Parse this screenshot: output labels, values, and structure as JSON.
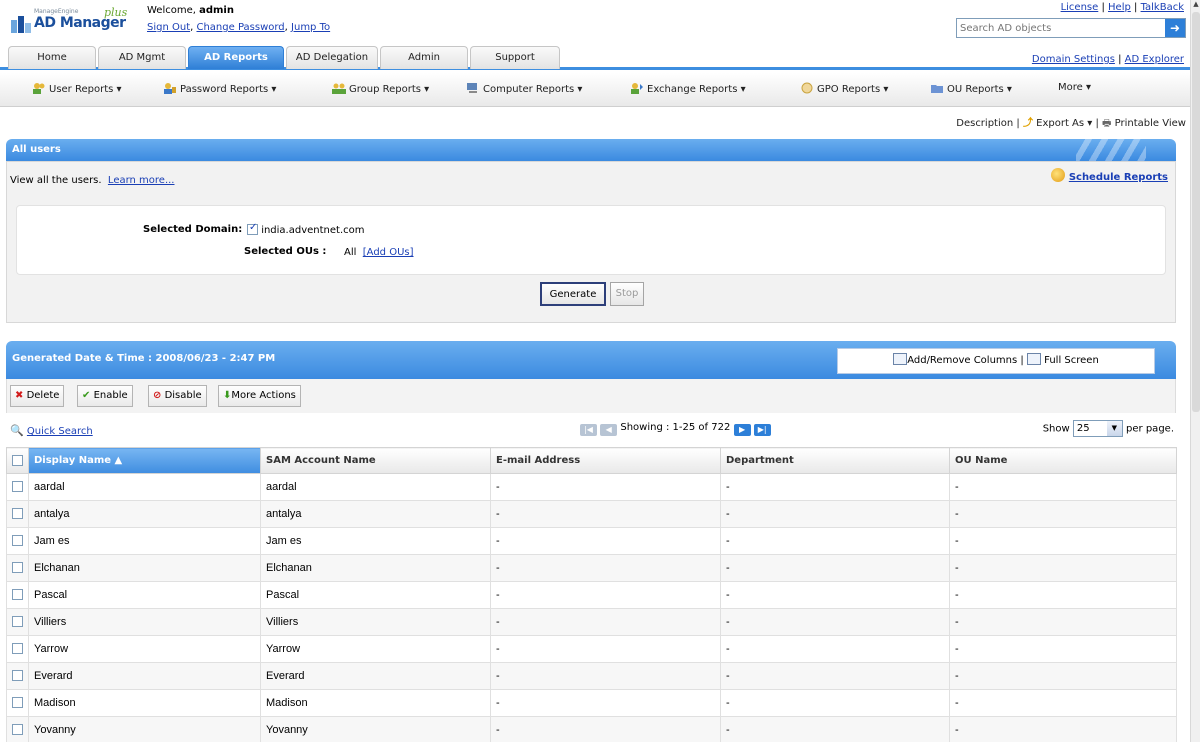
{
  "header": {
    "brand_small": "ManageEngine",
    "brand_name": "AD Manager",
    "brand_plus": "plus",
    "welcome_prefix": "Welcome,",
    "welcome_user": "admin",
    "links": [
      "Sign Out",
      "Change Password",
      "Jump To"
    ],
    "top_links": [
      "License",
      "Help",
      "TalkBack"
    ],
    "search_placeholder": "Search AD objects"
  },
  "tabs": [
    {
      "label": "Home",
      "active": false
    },
    {
      "label": "AD Mgmt",
      "active": false
    },
    {
      "label": "AD Reports",
      "active": true
    },
    {
      "label": "AD Delegation",
      "active": false
    },
    {
      "label": "Admin",
      "active": false
    },
    {
      "label": "Support",
      "active": false
    }
  ],
  "tabs_right": [
    "Domain Settings",
    "AD Explorer"
  ],
  "submenu": [
    "User Reports ▾",
    "Password Reports ▾",
    "Group Reports ▾",
    "Computer Reports ▾",
    "Exchange Reports ▾",
    "GPO Reports ▾",
    "OU Reports ▾",
    "More ▾"
  ],
  "viewbar": {
    "description": "Description",
    "export": "Export As ▾",
    "print": "Printable View"
  },
  "report": {
    "title": "All users",
    "desc": "View all the users.",
    "learn_more": "Learn more...",
    "schedule": "Schedule Reports",
    "domain_label": "Selected Domain:",
    "domain_value": "india.adventnet.com",
    "ou_label": "Selected OUs :",
    "ou_value": "All",
    "add_ous": "[Add OUs]",
    "generate": "Generate",
    "stop": "Stop"
  },
  "results": {
    "generated": "Generated Date & Time : 2008/06/23 - 2:47 PM",
    "add_remove": "Add/Remove Columns",
    "full_screen": "Full Screen",
    "actions": [
      "Delete",
      "Enable",
      "Disable",
      "More Actions"
    ],
    "quick_search": "Quick Search",
    "showing": "Showing : 1-25 of 722",
    "show_label": "Show",
    "per_page_value": "25",
    "per_page_suffix": "per page."
  },
  "columns": [
    "Display Name ▲",
    "SAM Account Name",
    "E-mail Address",
    "Department",
    "OU Name"
  ],
  "rows": [
    {
      "display": "aardal",
      "sam": "aardal",
      "email": "-",
      "dept": "-",
      "ou": "-"
    },
    {
      "display": "antalya",
      "sam": "antalya",
      "email": "-",
      "dept": "-",
      "ou": "-"
    },
    {
      "display": "Jam es",
      "sam": "Jam es",
      "email": "-",
      "dept": "-",
      "ou": "-"
    },
    {
      "display": "Elchanan",
      "sam": "Elchanan",
      "email": "-",
      "dept": "-",
      "ou": "-"
    },
    {
      "display": "Pascal",
      "sam": "Pascal",
      "email": "-",
      "dept": "-",
      "ou": "-"
    },
    {
      "display": "Villiers",
      "sam": "Villiers",
      "email": "-",
      "dept": "-",
      "ou": "-"
    },
    {
      "display": "Yarrow",
      "sam": "Yarrow",
      "email": "-",
      "dept": "-",
      "ou": "-"
    },
    {
      "display": "Everard",
      "sam": "Everard",
      "email": "-",
      "dept": "-",
      "ou": "-"
    },
    {
      "display": "Madison",
      "sam": "Madison",
      "email": "-",
      "dept": "-",
      "ou": "-"
    },
    {
      "display": "Yovanny",
      "sam": "Yovanny",
      "email": "-",
      "dept": "-",
      "ou": "-"
    }
  ]
}
